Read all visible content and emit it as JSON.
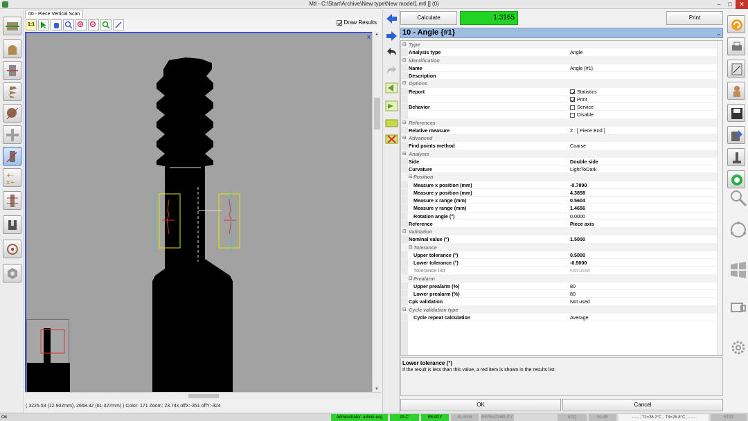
{
  "window": {
    "title": "Mtl - C:\\Start\\Archive\\New type\\New model1.mtl [] (0)"
  },
  "image_pane": {
    "tab_label": "00 - Piece Vertical Scan",
    "zoom_1to1_label": "1:1",
    "draw_results_label": "Draw Results",
    "draw_results_checked": true,
    "status_text": "( 3225.53 (12.902mm), 2668.32 (61.327mm) ) Color: 171   Zoom: 23.74x   offX:-351   offY:-324"
  },
  "toolbar": {
    "calculate_label": "Calculate",
    "result_value": "1.3165",
    "print_label": "Print"
  },
  "measure": {
    "title": "10 - Angle {#1}"
  },
  "properties": {
    "type_header": "Type",
    "analysis_type_label": "Analysis type",
    "analysis_type_value": "Angle",
    "identification_header": "Identification",
    "name_label": "Name",
    "name_value": "Angle {#1}",
    "description_label": "Description",
    "options_header": "Options",
    "report_label": "Report",
    "statistics_label": "Statistics",
    "print_label": "Print",
    "behavior_label": "Behavior",
    "service_label": "Service",
    "disable_label": "Disable",
    "references_header": "References",
    "relative_measure_label": "Relative measure",
    "relative_measure_value": "2 : [ Piece End ]",
    "advanced_header": "Advanced",
    "find_points_label": "Find points method",
    "find_points_value": "Coarse",
    "analysis_header": "Analysis",
    "side_label": "Side",
    "side_value": "Double side",
    "curvature_label": "Curvature",
    "curvature_value": "LightToDark",
    "position_header": "Position",
    "mx_pos_label": "Measure x position (mm)",
    "mx_pos_value": "-0.7890",
    "my_pos_label": "Measure y position (mm)",
    "my_pos_value": "4.3858",
    "mx_range_label": "Measure x range (mm)",
    "mx_range_value": "0.5604",
    "my_range_label": "Measure y range (mm)",
    "my_range_value": "1.4656",
    "rotation_label": "Rotation angle (°)",
    "rotation_value": "0.0000",
    "reference_label": "Reference",
    "reference_value": "Piece axis",
    "validation_header": "Validation",
    "nominal_label": "Nominal value (°)",
    "nominal_value": "1.5000",
    "tolerance_header": "Tolerance",
    "upper_tol_label": "Upper tolerance (°)",
    "upper_tol_value": "0.5000",
    "lower_tol_label": "Lower tolerance (°)",
    "lower_tol_value": "-0.5000",
    "tol_list_label": "Tolerance list",
    "tol_list_value": "Not used",
    "prealarm_header": "Prealarm",
    "upper_pre_label": "Upper prealarm (%)",
    "upper_pre_value": "80",
    "lower_pre_label": "Lower prealarm (%)",
    "lower_pre_value": "80",
    "cpk_label": "Cpk validation",
    "cpk_value": "Not used",
    "cycle_header": "Cycle validation type",
    "cycle_repeat_label": "Cycle repeat calculation",
    "cycle_repeat_value": "Average"
  },
  "description": {
    "title": "Lower tolerance (°)",
    "text": "If the result is less than this value, a red item is shown in the results list."
  },
  "dialog": {
    "ok_label": "OK",
    "cancel_label": "Cancel"
  },
  "statusbar": {
    "left_text": "Ok",
    "user": "Administrator: admin-eng",
    "plc": "PLC",
    "ready": "READY",
    "alarm": "ALARM",
    "repeatability": "REPEATABILITY",
    "acq": "ACQ",
    "elab": "ELAB",
    "temps": "- - - ; T2=26.2°C ; T3=25.8°C ; - - -",
    "stat": "STAT"
  },
  "colors": {
    "result_ok": "#22d422",
    "selection_blue": "#3a52d6",
    "title_blue": "#9fbde0"
  }
}
